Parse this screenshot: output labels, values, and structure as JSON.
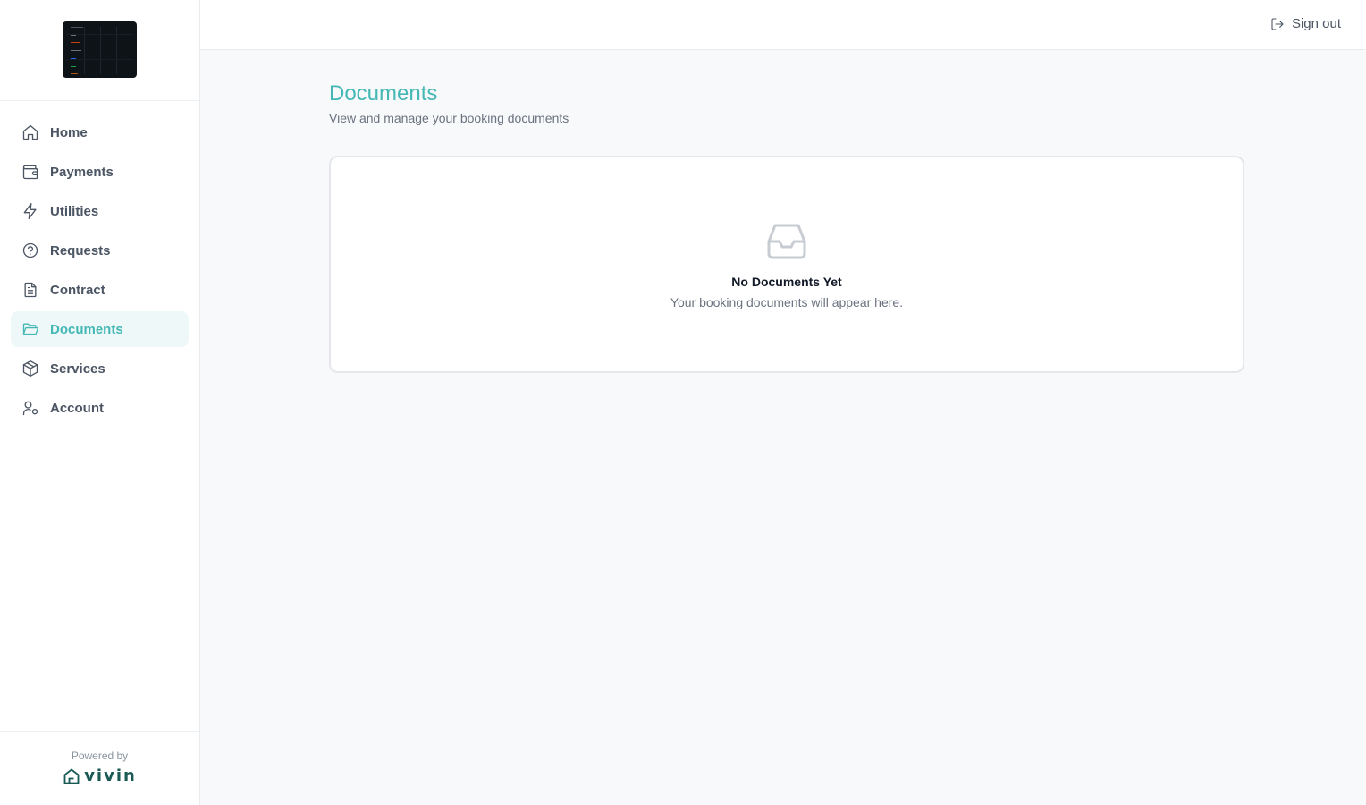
{
  "sidebar": {
    "logo_name": "logo",
    "items": [
      {
        "label": "Home",
        "icon": "home-icon"
      },
      {
        "label": "Payments",
        "icon": "wallet-icon"
      },
      {
        "label": "Utilities",
        "icon": "lightning-icon"
      },
      {
        "label": "Requests",
        "icon": "question-circle-icon"
      },
      {
        "label": "Contract",
        "icon": "document-icon"
      },
      {
        "label": "Documents",
        "icon": "folder-open-icon",
        "active": true
      },
      {
        "label": "Services",
        "icon": "package-icon"
      },
      {
        "label": "Account",
        "icon": "user-settings-icon"
      }
    ],
    "powered_by": "Powered by",
    "brand": "vivin"
  },
  "topbar": {
    "signout_label": "Sign out"
  },
  "main": {
    "title": "Documents",
    "subtitle": "View and manage your booking documents",
    "empty_state": {
      "icon": "inbox-icon",
      "title": "No Documents Yet",
      "message": "Your booking documents will appear here."
    }
  },
  "colors": {
    "accent": "#45b8b6",
    "active_bg": "#eef8f8",
    "page_bg": "#f7f9fa",
    "brand": "#1a5a55"
  }
}
